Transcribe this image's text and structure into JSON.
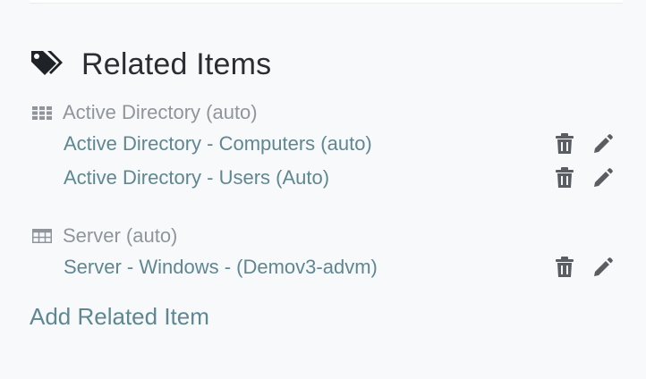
{
  "related_items": {
    "title": "Related Items",
    "groups": [
      {
        "label": "Active Directory (auto)",
        "icon": "grid-icon",
        "items": [
          {
            "label": "Active Directory - Computers (auto)"
          },
          {
            "label": "Active Directory - Users (Auto)"
          }
        ]
      },
      {
        "label": "Server (auto)",
        "icon": "table-icon",
        "items": [
          {
            "label": "Server - Windows - (Demov3-advm)"
          }
        ]
      }
    ],
    "add_label": "Add Related Item"
  },
  "colors": {
    "link": "#5f8791",
    "muted": "#8f959b",
    "title": "#2a2d31",
    "icon": "#5a5e63",
    "background": "#f8f9fb"
  }
}
